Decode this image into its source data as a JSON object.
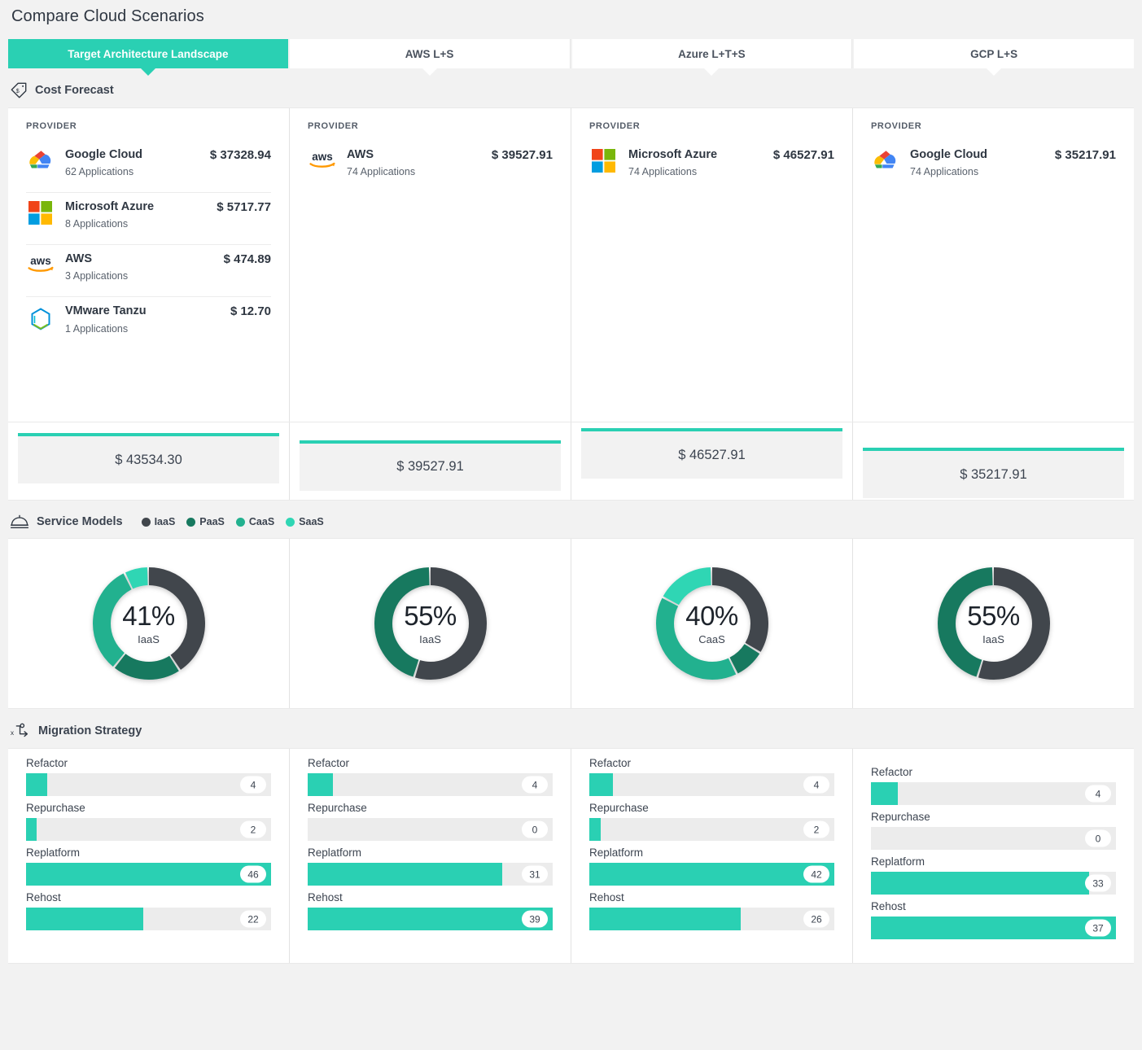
{
  "page": {
    "title": "Compare Cloud Scenarios"
  },
  "accent": {
    "teal": "#2ad0b3",
    "iaas": "#41464c",
    "paas": "#17795f",
    "caas": "#22b18f",
    "saas": "#2fd6b4"
  },
  "tabs": [
    {
      "label": "Target Architecture Landscape",
      "active": true
    },
    {
      "label": "AWS L+S",
      "active": false
    },
    {
      "label": "Azure L+T+S",
      "active": false
    },
    {
      "label": "GCP L+S",
      "active": false
    }
  ],
  "cost_forecast": {
    "section_title": "Cost Forecast",
    "icon": "price-tag-icon",
    "column_label": "PROVIDER",
    "columns": [
      {
        "providers": [
          {
            "logo": "google-cloud-logo",
            "name": "Google Cloud",
            "apps": "62 Applications",
            "cost": "$ 37328.94"
          },
          {
            "logo": "microsoft-azure-logo",
            "name": "Microsoft Azure",
            "apps": "8 Applications",
            "cost": "$ 5717.77"
          },
          {
            "logo": "aws-logo",
            "name": "AWS",
            "apps": "3 Applications",
            "cost": "$ 474.89"
          },
          {
            "logo": "vmware-tanzu-logo",
            "name": "VMware Tanzu",
            "apps": "1 Applications",
            "cost": "$ 12.70"
          }
        ],
        "total": "$ 43534.30"
      },
      {
        "providers": [
          {
            "logo": "aws-logo",
            "name": "AWS",
            "apps": "74 Applications",
            "cost": "$ 39527.91"
          }
        ],
        "total": "$ 39527.91"
      },
      {
        "providers": [
          {
            "logo": "microsoft-azure-logo",
            "name": "Microsoft Azure",
            "apps": "74 Applications",
            "cost": "$ 46527.91"
          }
        ],
        "total": "$ 46527.91"
      },
      {
        "providers": [
          {
            "logo": "google-cloud-logo",
            "name": "Google Cloud",
            "apps": "74 Applications",
            "cost": "$ 35217.91"
          }
        ],
        "total": "$ 35217.91"
      }
    ]
  },
  "service_models": {
    "section_title": "Service Models",
    "icon": "service-bell-icon",
    "legend": [
      {
        "label": "IaaS",
        "color": "#41464c"
      },
      {
        "label": "PaaS",
        "color": "#17795f"
      },
      {
        "label": "CaaS",
        "color": "#22b18f"
      },
      {
        "label": "SaaS",
        "color": "#2fd6b4"
      }
    ],
    "donuts": [
      {
        "percent": "41%",
        "highlight": "IaaS",
        "segments": [
          {
            "label": "IaaS",
            "value": 41,
            "color": "#41464c"
          },
          {
            "label": "PaaS",
            "value": 20,
            "color": "#17795f"
          },
          {
            "label": "CaaS",
            "value": 32,
            "color": "#22b18f"
          },
          {
            "label": "SaaS",
            "value": 7,
            "color": "#2fd6b4"
          }
        ]
      },
      {
        "percent": "55%",
        "highlight": "IaaS",
        "segments": [
          {
            "label": "IaaS",
            "value": 55,
            "color": "#41464c"
          },
          {
            "label": "PaaS",
            "value": 45,
            "color": "#17795f"
          }
        ]
      },
      {
        "percent": "40%",
        "highlight": "CaaS",
        "segments": [
          {
            "label": "IaaS",
            "value": 34,
            "color": "#41464c"
          },
          {
            "label": "PaaS",
            "value": 9,
            "color": "#17795f"
          },
          {
            "label": "CaaS",
            "value": 40,
            "color": "#22b18f"
          },
          {
            "label": "SaaS",
            "value": 17,
            "color": "#2fd6b4"
          }
        ]
      },
      {
        "percent": "55%",
        "highlight": "IaaS",
        "segments": [
          {
            "label": "IaaS",
            "value": 55,
            "color": "#41464c"
          },
          {
            "label": "PaaS",
            "value": 45,
            "color": "#17795f"
          }
        ]
      }
    ]
  },
  "migration_strategy": {
    "section_title": "Migration Strategy",
    "icon": "migration-route-icon",
    "columns": [
      {
        "offset": 0,
        "items": [
          {
            "label": "Refactor",
            "value": 4
          },
          {
            "label": "Repurchase",
            "value": 2
          },
          {
            "label": "Replatform",
            "value": 46
          },
          {
            "label": "Rehost",
            "value": 22
          }
        ]
      },
      {
        "offset": 0,
        "items": [
          {
            "label": "Refactor",
            "value": 4
          },
          {
            "label": "Repurchase",
            "value": 0
          },
          {
            "label": "Replatform",
            "value": 31
          },
          {
            "label": "Rehost",
            "value": 39
          }
        ]
      },
      {
        "offset": 0,
        "items": [
          {
            "label": "Refactor",
            "value": 4
          },
          {
            "label": "Repurchase",
            "value": 2
          },
          {
            "label": "Replatform",
            "value": 42
          },
          {
            "label": "Rehost",
            "value": 26
          }
        ]
      },
      {
        "offset": 11,
        "items": [
          {
            "label": "Refactor",
            "value": 4
          },
          {
            "label": "Repurchase",
            "value": 0
          },
          {
            "label": "Replatform",
            "value": 33
          },
          {
            "label": "Rehost",
            "value": 37
          }
        ]
      }
    ]
  }
}
